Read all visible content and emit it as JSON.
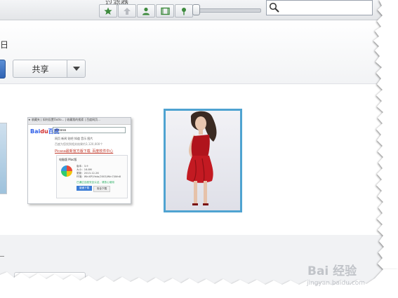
{
  "filter_bar": {
    "label": "过滤器",
    "buttons": [
      {
        "icon": "star-icon"
      },
      {
        "icon": "upload-icon"
      },
      {
        "icon": "person-icon"
      },
      {
        "icon": "film-icon"
      },
      {
        "icon": "pin-icon"
      }
    ],
    "search_placeholder": ""
  },
  "header": {
    "date_text": "日",
    "share_label": "共享"
  },
  "thumbnails": {
    "screenshot": {
      "tabs_text": "★ 收藏夹 | 如何设置Outlo... | 收藏我的搜索 | 百度网页...",
      "logo_bai": "Bai",
      "logo_du": "du",
      "logo_suffix": "百度",
      "query": "picasa",
      "nav": "网页  新闻  贴吧  知道  音乐  图片",
      "meta": "百度为您找到相关结果约3,120,000个",
      "result_title": "Picasa最新官方版下载_百度软件中心",
      "card_tabs": "电脑版    Mac版",
      "info_lines": [
        "版本：3.9",
        "大小：16.8M",
        "更新：2013-12-26",
        "环境：WinXP/Vista/2003/Win7/Win8"
      ],
      "safe_text": "已通过百度安全认证，请放心使用",
      "download_label": "普通下载",
      "secure_label": "安全下载"
    }
  },
  "watermark": {
    "main": "Bai 经验",
    "sub": "jingyan.baidu.com"
  }
}
